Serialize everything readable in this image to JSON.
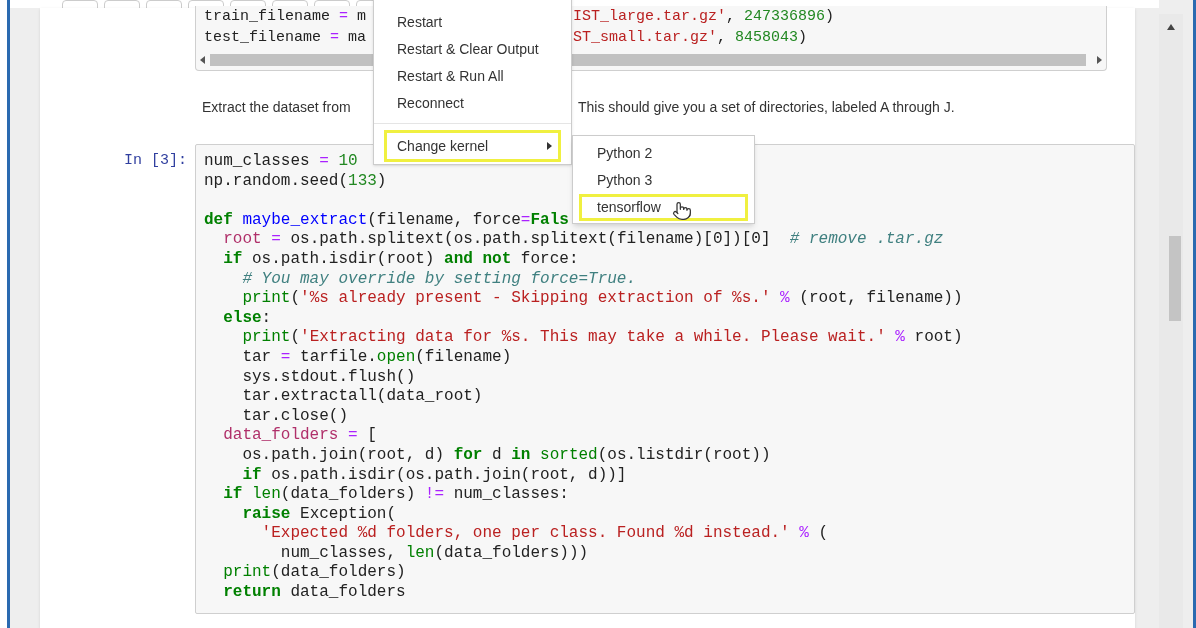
{
  "cell_1": {
    "lines": [
      {
        "left": [
          {
            "kind": "plain",
            "text": "train_filename "
          },
          {
            "kind": "operator",
            "text": "="
          },
          {
            "kind": "plain",
            "text": " m"
          }
        ],
        "right": [
          {
            "kind": "string",
            "text": "IST_large.tar.gz'"
          },
          {
            "kind": "plain",
            "text": ", "
          },
          {
            "kind": "number",
            "text": "247336896"
          },
          {
            "kind": "plain",
            "text": ")"
          }
        ]
      },
      {
        "left": [
          {
            "kind": "plain",
            "text": "test_filename "
          },
          {
            "kind": "operator",
            "text": "="
          },
          {
            "kind": "plain",
            "text": " ma"
          }
        ],
        "right": [
          {
            "kind": "string",
            "text": "ST_small.tar.gz'"
          },
          {
            "kind": "plain",
            "text": ", "
          },
          {
            "kind": "number",
            "text": "8458043"
          },
          {
            "kind": "plain",
            "text": ")"
          }
        ]
      }
    ]
  },
  "text_cell": {
    "left": "Extract the dataset from",
    "right": "This should give you a set of directories, labeled A through J."
  },
  "cell_2": {
    "prompt": "In [3]:",
    "lines": [
      {
        "kind": "code",
        "tokens": [
          {
            "kind": "plain",
            "text": "num_classes "
          },
          {
            "kind": "operator",
            "text": "="
          },
          {
            "kind": "number",
            "text": " 10"
          }
        ]
      },
      {
        "kind": "code",
        "tokens": [
          {
            "kind": "plain",
            "text": "np.random.seed("
          },
          {
            "kind": "number",
            "text": "133"
          },
          {
            "kind": "plain",
            "text": ")"
          }
        ]
      },
      {
        "kind": "blank"
      },
      {
        "kind": "code",
        "tokens": [
          {
            "kind": "keyword",
            "text": "def"
          },
          {
            "kind": "defname",
            "text": " maybe_extract"
          },
          {
            "kind": "plain",
            "text": "(filename, force"
          },
          {
            "kind": "operator",
            "text": "="
          },
          {
            "kind": "keyword",
            "text": "Fals"
          }
        ]
      },
      {
        "kind": "code",
        "tokens": [
          {
            "kind": "variable",
            "text": "  root "
          },
          {
            "kind": "operator",
            "text": "="
          },
          {
            "kind": "plain",
            "text": " os.path.splitext(os.path.splitext(filename)[0])[0]  "
          },
          {
            "kind": "comment",
            "text": "# remove .tar.gz"
          }
        ]
      },
      {
        "kind": "code",
        "tokens": [
          {
            "kind": "keyword",
            "text": "  if"
          },
          {
            "kind": "plain",
            "text": " os.path.isdir(root) "
          },
          {
            "kind": "keyword",
            "text": "and not"
          },
          {
            "kind": "plain",
            "text": " force:"
          }
        ]
      },
      {
        "kind": "code",
        "tokens": [
          {
            "kind": "comment",
            "text": "    # You may override by setting force=True."
          }
        ]
      },
      {
        "kind": "code",
        "tokens": [
          {
            "kind": "builtin",
            "text": "    print"
          },
          {
            "kind": "plain",
            "text": "("
          },
          {
            "kind": "string",
            "text": "'%s already present - Skipping extraction of %s.'"
          },
          {
            "kind": "operator",
            "text": " %"
          },
          {
            "kind": "plain",
            "text": " (root, filename))"
          }
        ]
      },
      {
        "kind": "code",
        "tokens": [
          {
            "kind": "keyword",
            "text": "  else"
          },
          {
            "kind": "plain",
            "text": ":"
          }
        ]
      },
      {
        "kind": "code",
        "tokens": [
          {
            "kind": "builtin",
            "text": "    print"
          },
          {
            "kind": "plain",
            "text": "("
          },
          {
            "kind": "string",
            "text": "'Extracting data for %s. This may take a while. Please wait.'"
          },
          {
            "kind": "operator",
            "text": " %"
          },
          {
            "kind": "plain",
            "text": " root)"
          }
        ]
      },
      {
        "kind": "code",
        "tokens": [
          {
            "kind": "plain",
            "text": "    tar "
          },
          {
            "kind": "operator",
            "text": "="
          },
          {
            "kind": "plain",
            "text": " tarfile."
          },
          {
            "kind": "builtin",
            "text": "open"
          },
          {
            "kind": "plain",
            "text": "(filename)"
          }
        ]
      },
      {
        "kind": "code",
        "tokens": [
          {
            "kind": "plain",
            "text": "    sys.stdout.flush()"
          }
        ]
      },
      {
        "kind": "code",
        "tokens": [
          {
            "kind": "plain",
            "text": "    tar.extractall(data_root)"
          }
        ]
      },
      {
        "kind": "code",
        "tokens": [
          {
            "kind": "plain",
            "text": "    tar.close()"
          }
        ]
      },
      {
        "kind": "code",
        "tokens": [
          {
            "kind": "variable",
            "text": "  data_folders "
          },
          {
            "kind": "operator",
            "text": "="
          },
          {
            "kind": "plain",
            "text": " ["
          }
        ]
      },
      {
        "kind": "code",
        "tokens": [
          {
            "kind": "plain",
            "text": "    os.path.join(root, d) "
          },
          {
            "kind": "keyword",
            "text": "for"
          },
          {
            "kind": "plain",
            "text": " d "
          },
          {
            "kind": "keyword",
            "text": "in"
          },
          {
            "kind": "builtin",
            "text": " sorted"
          },
          {
            "kind": "plain",
            "text": "(os.listdir(root))"
          }
        ]
      },
      {
        "kind": "code",
        "tokens": [
          {
            "kind": "keyword",
            "text": "    if"
          },
          {
            "kind": "plain",
            "text": " os.path.isdir(os.path.join(root, d))]"
          }
        ]
      },
      {
        "kind": "code",
        "tokens": [
          {
            "kind": "keyword",
            "text": "  if"
          },
          {
            "kind": "builtin",
            "text": " len"
          },
          {
            "kind": "plain",
            "text": "(data_folders) "
          },
          {
            "kind": "operator",
            "text": "!="
          },
          {
            "kind": "plain",
            "text": " num_classes:"
          }
        ]
      },
      {
        "kind": "code",
        "tokens": [
          {
            "kind": "keyword",
            "text": "    raise"
          },
          {
            "kind": "plain",
            "text": " Exception("
          }
        ]
      },
      {
        "kind": "code",
        "tokens": [
          {
            "kind": "string",
            "text": "      'Expected %d folders, one per class. Found %d instead.'"
          },
          {
            "kind": "operator",
            "text": " %"
          },
          {
            "kind": "plain",
            "text": " ("
          }
        ]
      },
      {
        "kind": "code",
        "tokens": [
          {
            "kind": "plain",
            "text": "        num_classes, "
          },
          {
            "kind": "builtin",
            "text": "len"
          },
          {
            "kind": "plain",
            "text": "(data_folders)))"
          }
        ]
      },
      {
        "kind": "code",
        "tokens": [
          {
            "kind": "builtin",
            "text": "  print"
          },
          {
            "kind": "plain",
            "text": "(data_folders)"
          }
        ]
      },
      {
        "kind": "code",
        "tokens": [
          {
            "kind": "keyword",
            "text": "  return"
          },
          {
            "kind": "plain",
            "text": " data_folders"
          }
        ]
      }
    ]
  },
  "kernel_menu": {
    "items": [
      {
        "kind": "item",
        "label": "Restart",
        "highlighted": false
      },
      {
        "kind": "item",
        "label": "Restart & Clear Output",
        "highlighted": false
      },
      {
        "kind": "item",
        "label": "Restart & Run All",
        "highlighted": false
      },
      {
        "kind": "item",
        "label": "Reconnect",
        "highlighted": false
      },
      {
        "kind": "divider"
      },
      {
        "kind": "submenu",
        "label": "Change kernel",
        "highlighted": true
      }
    ]
  },
  "kernel_submenu": {
    "items": [
      {
        "label": "Python 2",
        "highlighted": false
      },
      {
        "label": "Python 3",
        "highlighted": false
      },
      {
        "label": "tensorflow",
        "highlighted": true
      }
    ]
  }
}
